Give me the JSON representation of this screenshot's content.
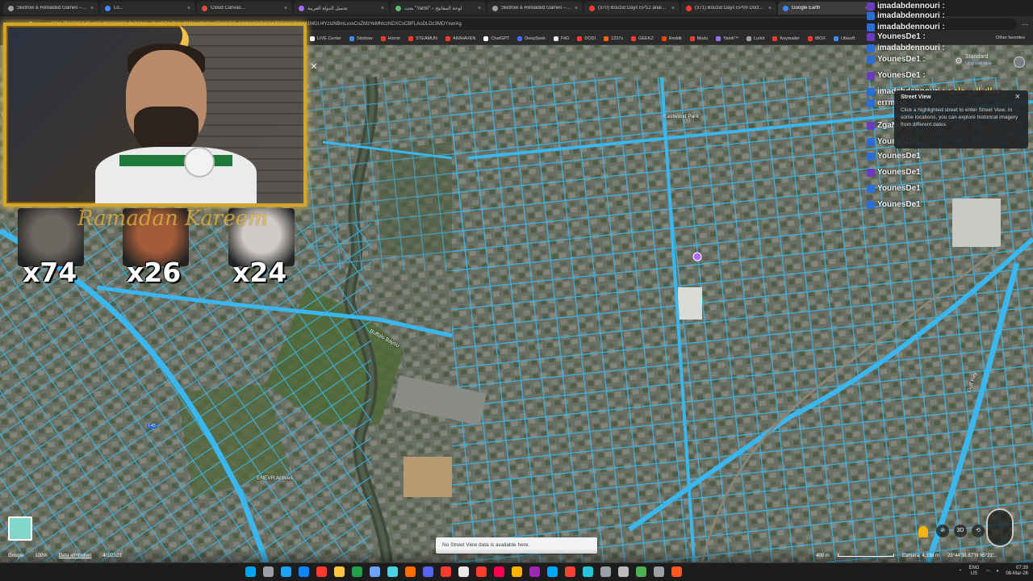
{
  "browser": {
    "tabs": [
      {
        "label": "Skidrow & Reloaded Games – Do...",
        "color": "#9aa0a6"
      },
      {
        "label": "Lo...",
        "color": "#3c8cff"
      },
      {
        "label": "Cloud Canvas...",
        "color": "#e04b3a"
      },
      {
        "label": "تحميل الدولة العربية",
        "color": "#a66cff"
      },
      {
        "label": "بحث \"Yamli\" – لوحة المفاتيح",
        "color": "#5bbf6a"
      },
      {
        "label": "Skidrow & Reloaded Games – Do...",
        "color": "#9aa0a6"
      },
      {
        "label": "(370) Bouzid Days EP12 analyses",
        "color": "#ff3b30"
      },
      {
        "label": "(371) Bouzid Days EP09 Docteur p...",
        "color": "#ff3b30"
      },
      {
        "label": "Google Earth",
        "color": "#4285f4"
      }
    ],
    "new_tab": "+",
    "address": "...4324.7564735d,35y,111.91022661h,0t,0r/data=CogBGloSVAoINMHg4NjQwOTY0NDEyNWNkNDZiOjB4ZDFlOGZhNWI1MGU4YzIzNBmLxxxCoZMzYeMhtczNDXCsCBFLAoDLDc3MDYxwrAg",
    "bookmarks": [
      {
        "label": "LIVE Center",
        "color": "#ffffff"
      },
      {
        "label": "Skidrow",
        "color": "#3c8cff"
      },
      {
        "label": "Horror",
        "color": "#ff3b30"
      },
      {
        "label": "STEAMUN",
        "color": "#ff3b30"
      },
      {
        "label": "AIMHAVEN",
        "color": "#ff3b30"
      },
      {
        "label": "ChatGPT",
        "color": "#ffffff"
      },
      {
        "label": "DeepSeek",
        "color": "#4d6bfe"
      },
      {
        "label": "FitG",
        "color": "#e8e8e8"
      },
      {
        "label": "DODI",
        "color": "#ff3b30"
      },
      {
        "label": "1337x",
        "color": "#ff6a00"
      },
      {
        "label": "GEEKZ",
        "color": "#ff3b30"
      },
      {
        "label": "Reddit",
        "color": "#ff4500"
      },
      {
        "label": "Mods",
        "color": "#ff3b30"
      },
      {
        "label": "Yamli™",
        "color": "#a66cff"
      },
      {
        "label": "Lurkit",
        "color": "#9aa0a6"
      },
      {
        "label": "Keymailer",
        "color": "#ff3b30"
      },
      {
        "label": "IBOX",
        "color": "#ff3b30"
      },
      {
        "label": "Ubisoft",
        "color": "#3c8cff"
      }
    ],
    "other_favorites": "Other favorites"
  },
  "overlay": {
    "emotes": [
      {
        "count": "x74",
        "color": "#6b6660"
      },
      {
        "count": "x26",
        "color": "#a35b3a"
      },
      {
        "count": "x24",
        "color": "#cfcbc6"
      }
    ],
    "ramadan_text": "Ramadan Kareem"
  },
  "chat": {
    "lines": [
      {
        "user": "imadabdennouri :",
        "msg": ""
      },
      {
        "user": "imadabdennouri :",
        "msg": ""
      },
      {
        "user": "imadabdennouri :",
        "msg": ""
      },
      {
        "user": "YounesDe1 :",
        "msg": ""
      },
      {
        "user": "imadabdennouri :",
        "msg": ""
      },
      {
        "user": "YounesDe1 :",
        "msg": ""
      },
      {
        "user": "YounesDe1 :",
        "msg": ""
      },
      {
        "user": "imadabdennouri :",
        "msg": "بعطك الف عافية"
      },
      {
        "user": "errm_jo :",
        "msg": ""
      },
      {
        "user": "ZgaNgay :",
        "msg": ""
      },
      {
        "user": "YounesDe1",
        "msg": ""
      },
      {
        "user": "YounesDe1",
        "msg": ""
      },
      {
        "user": "YounesDe1",
        "msg": ""
      },
      {
        "user": "YounesDe1",
        "msg": ""
      },
      {
        "user": "YounesDe1",
        "msg": ""
      }
    ]
  },
  "account": {
    "plan": "Standard",
    "upgrade": "Upgrade now"
  },
  "street_view_popup": {
    "title": "Street View",
    "body": "Click a highlighted street to enter Street View. In some locations, you can explore historical imagery from different dates.",
    "close": "×"
  },
  "map": {
    "labels": [
      {
        "text": "Eastwood Park"
      },
      {
        "text": "Buffalo Bayou"
      },
      {
        "text": "ENEVR Actives"
      },
      {
        "text": "I-45"
      },
      {
        "text": "Gulf Fwy"
      }
    ],
    "toast": "No Street View data is available here.",
    "status": {
      "brand": "Google",
      "zoom": "100%",
      "attribution": "Data attribution",
      "date": "4/1/2023",
      "scale": "400 m",
      "camera": "Camera: 4,338 m",
      "coords": "29°44'38.87\"N 95°21'..."
    },
    "controls": [
      "3D",
      "⟲",
      "◐"
    ]
  },
  "taskbar": {
    "icons": [
      "#00a4ef",
      "#9aa0a6",
      "#1da1f2",
      "#0a84ff",
      "#ff3b30",
      "#ffc83d",
      "#22a04b",
      "#6aa4ff",
      "#4dd0e1",
      "#ff6d00",
      "#5865f2",
      "#ff3b30",
      "#e8e8e8",
      "#ff3b30",
      "#ff0050",
      "#ffb300",
      "#9c27b0",
      "#03a9f4",
      "#f44336",
      "#26c6da",
      "#9aa0a6",
      "#bdbdbd",
      "#4caf50",
      "#9aa0a6",
      "#ff5722"
    ],
    "lang": "ENG",
    "region": "US",
    "time": "07:39",
    "date": "08-Mar-26"
  },
  "colors": {
    "street_view_blue": "#39b7ee",
    "frame_gold": "#d4a52b",
    "chat_name": "#f0f0f0",
    "chat_badge": "#2a6dd6"
  }
}
